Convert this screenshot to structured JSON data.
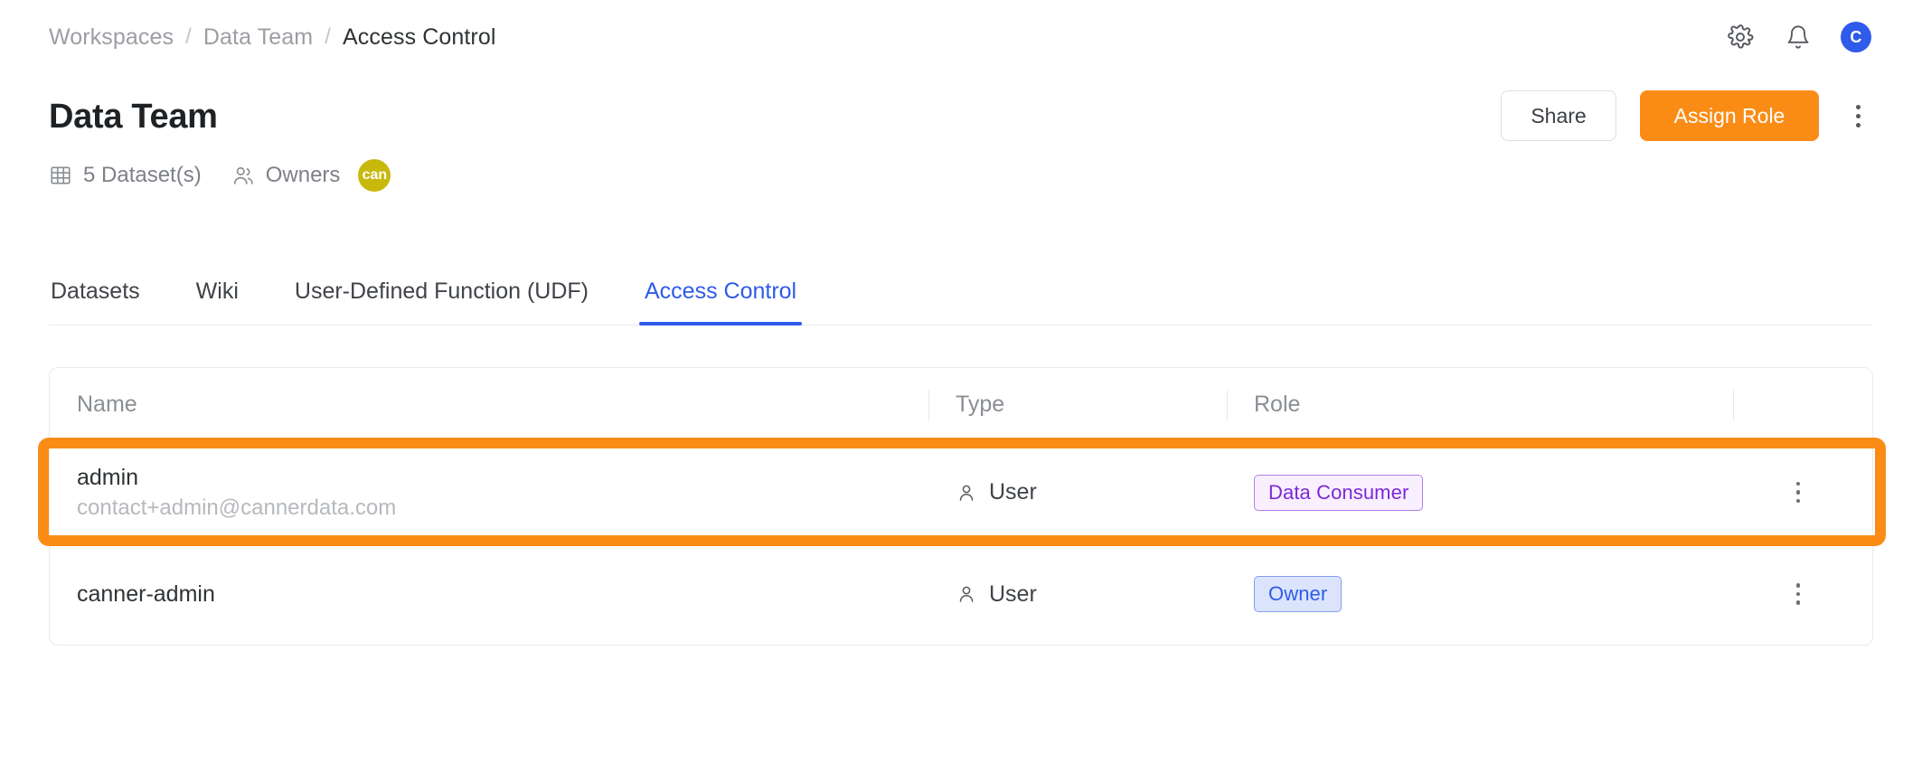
{
  "breadcrumb": {
    "items": [
      {
        "label": "Workspaces",
        "current": false
      },
      {
        "label": "Data Team",
        "current": false
      },
      {
        "label": "Access Control",
        "current": true
      }
    ],
    "separator": "/"
  },
  "topbar": {
    "settings_icon": "gear-icon",
    "notifications_icon": "bell-icon",
    "avatar_initial": "C",
    "avatar_color": "#2f5bea"
  },
  "header": {
    "title": "Data Team",
    "share_label": "Share",
    "assign_label": "Assign Role",
    "assign_color": "#fa8c16",
    "more_icon": "kebab-menu-icon",
    "meta": {
      "datasets_icon": "table-grid-icon",
      "datasets_label": "5 Dataset(s)",
      "owners_icon": "people-icon",
      "owners_label": "Owners",
      "owner_avatar_text": "can",
      "owner_avatar_color": "#c9b80c"
    }
  },
  "tabs": [
    {
      "label": "Datasets",
      "active": false
    },
    {
      "label": "Wiki",
      "active": false
    },
    {
      "label": "User-Defined Function (UDF)",
      "active": false
    },
    {
      "label": "Access Control",
      "active": true
    }
  ],
  "tab_active_color": "#2f5bea",
  "table": {
    "columns": [
      {
        "key": "name",
        "label": "Name"
      },
      {
        "key": "type",
        "label": "Type"
      },
      {
        "key": "role",
        "label": "Role"
      },
      {
        "key": "actions",
        "label": ""
      }
    ],
    "rows": [
      {
        "name": "admin",
        "email": "contact+admin@cannerdata.com",
        "type": "User",
        "type_icon": "user-icon",
        "role": "Data Consumer",
        "role_style": "purple",
        "highlighted": true,
        "actions_icon": "kebab-menu-icon"
      },
      {
        "name": "canner-admin",
        "email": "",
        "type": "User",
        "type_icon": "user-icon",
        "role": "Owner",
        "role_style": "blue",
        "highlighted": false,
        "actions_icon": "kebab-menu-icon"
      }
    ]
  },
  "highlight_color": "#fa8c16"
}
